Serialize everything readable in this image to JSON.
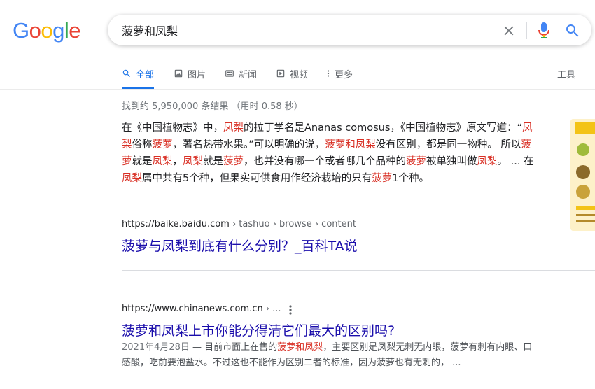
{
  "logo": {
    "g1": "G",
    "o1": "o",
    "o2": "o",
    "g2": "g",
    "l": "l",
    "e": "e"
  },
  "search": {
    "query": "菠萝和凤梨",
    "placeholder": ""
  },
  "tabs": [
    {
      "label": "全部",
      "icon": "search-icon",
      "active": true
    },
    {
      "label": "图片",
      "icon": "image-icon"
    },
    {
      "label": "新闻",
      "icon": "news-icon"
    },
    {
      "label": "视频",
      "icon": "video-icon"
    },
    {
      "label": "更多",
      "icon": "more-vert-icon"
    }
  ],
  "tools_label": "工具",
  "stats": "找到约 5,950,000 条结果 （用时 0.58 秒）",
  "featured": {
    "snippet": [
      {
        "t": "在《中国植物志》中，"
      },
      {
        "t": "凤梨",
        "h": true
      },
      {
        "t": "的拉丁学名是Ananas comosus，《中国植物志》原文写道：“"
      },
      {
        "t": "凤梨",
        "h": true
      },
      {
        "t": "俗称"
      },
      {
        "t": "菠萝",
        "h": true
      },
      {
        "t": "，著名热带水果。”可以明确的说，"
      },
      {
        "t": "菠萝和凤梨",
        "h": true
      },
      {
        "t": "没有区别，都是同一物种。 所以"
      },
      {
        "t": "菠萝",
        "h": true
      },
      {
        "t": "就是"
      },
      {
        "t": "凤梨",
        "h": true
      },
      {
        "t": "，"
      },
      {
        "t": "凤梨",
        "h": true
      },
      {
        "t": "就是"
      },
      {
        "t": "菠萝",
        "h": true
      },
      {
        "t": "，也并没有哪一个或者哪几个品种的"
      },
      {
        "t": "菠萝",
        "h": true
      },
      {
        "t": "被单独叫做"
      },
      {
        "t": "凤梨",
        "h": true
      },
      {
        "t": "。 ... 在"
      },
      {
        "t": "凤梨",
        "h": true
      },
      {
        "t": "属中共有5个种，但果实可供食用作经济栽培的只有"
      },
      {
        "t": "菠萝",
        "h": true
      },
      {
        "t": "1个种。"
      }
    ],
    "cite_domain": "https://baike.baidu.com",
    "cite_path": " › tashuo › browse › content",
    "title": "菠萝与凤梨到底有什么分别？_百科TA说"
  },
  "result2": {
    "cite_domain": "https://www.chinanews.com.cn",
    "cite_path": " › ...",
    "title": "菠萝和凤梨上市你能分得清它们最大的区别吗?",
    "date": "2021年4月28日",
    "desc": [
      {
        "t": " — 目前市面上在售的"
      },
      {
        "t": "菠萝和凤梨",
        "h": true
      },
      {
        "t": "，主要区别是凤梨无刺无内眼，菠萝有刺有内眼、口感酸，吃前要泡盐水。不过这也不能作为区别二者的标准，因为菠萝也有无刺的， ..."
      }
    ]
  },
  "colors": {
    "blue": "#4285f4",
    "red": "#ea4335",
    "yellow": "#fbbc05",
    "green": "#34a853",
    "link": "#1a0dab",
    "highlight": "#d93025"
  }
}
